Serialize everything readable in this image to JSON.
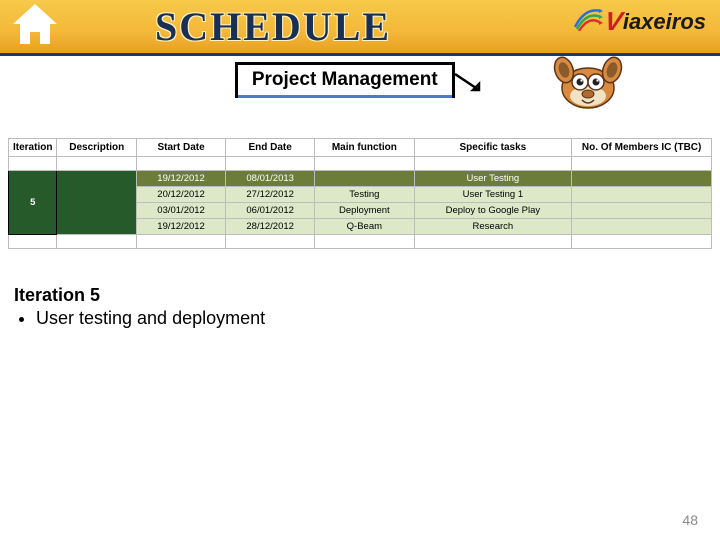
{
  "header": {
    "title": "SCHEDULE",
    "brand": "iaxeiros"
  },
  "subtitle": "Project Management",
  "table": {
    "columns": [
      "Iteration",
      "Description",
      "Start Date",
      "End Date",
      "Main function",
      "Specific tasks",
      "No. Of Members IC (TBC)"
    ],
    "iteration": "5",
    "rows": [
      {
        "start": "19/12/2012",
        "end": "08/01/2013",
        "main": "",
        "task": "User Testing",
        "mem": ""
      },
      {
        "start": "20/12/2012",
        "end": "27/12/2012",
        "main": "Testing",
        "task": "User Testing 1",
        "mem": ""
      },
      {
        "start": "03/01/2012",
        "end": "06/01/2012",
        "main": "Deployment",
        "task": "Deploy to Google Play",
        "mem": ""
      },
      {
        "start": "19/12/2012",
        "end": "28/12/2012",
        "main": "Q-Beam",
        "task": "Research",
        "mem": ""
      }
    ]
  },
  "notes": {
    "title": "Iteration 5",
    "bullets": [
      "User testing and deployment"
    ]
  },
  "page_number": "48"
}
